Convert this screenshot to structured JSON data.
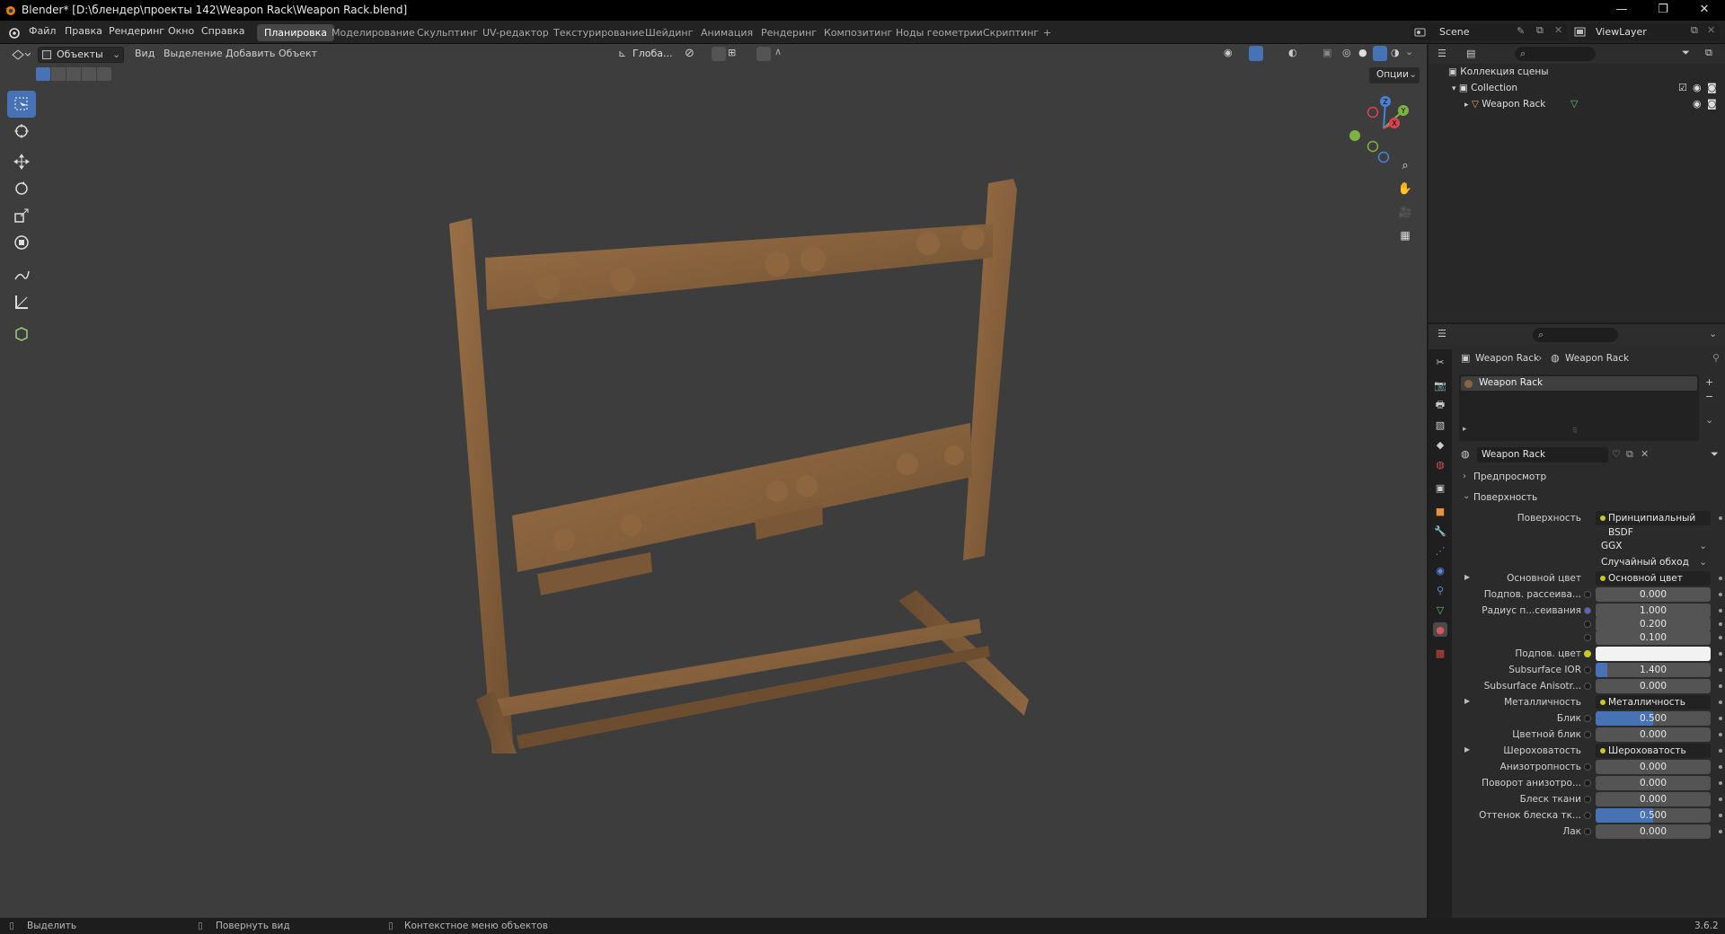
{
  "window": {
    "title": "Blender* [D:\\блендер\\проекты 142\\Weapon Rack\\Weapon Rack.blend]",
    "controls": [
      "—",
      "❐",
      "✕"
    ]
  },
  "menu": [
    "Файл",
    "Правка",
    "Рендеринг",
    "Окно",
    "Справка"
  ],
  "workspaces": [
    "Планировка",
    "Моделирование",
    "Скульптинг",
    "UV-редактор",
    "Текстурирование",
    "Шейдинг",
    "Анимация",
    "Рендеринг",
    "Композитинг",
    "Ноды геометрии",
    "Скриптинг",
    "+"
  ],
  "scene": {
    "label": "Scene",
    "view_layer": "ViewLayer"
  },
  "viewport_header": {
    "mode": "Объекты",
    "menus": [
      "Вид",
      "Выделение",
      "Добавить",
      "Объект"
    ],
    "orientation": "Глоба...",
    "options": "Опции"
  },
  "gizmo_axes": {
    "x": "X",
    "y": "Y",
    "z": "Z"
  },
  "outliner": {
    "scene_collection": "Коллекция сцены",
    "collection": "Collection",
    "object": "Weapon Rack"
  },
  "properties": {
    "breadcrumb_object": "Weapon Rack",
    "breadcrumb_material": "Weapon Rack",
    "slot": "Weapon Rack",
    "material_name": "Weapon Rack",
    "panel_preview": "Предпросмотр",
    "panel_surface": "Поверхность",
    "rows": [
      {
        "label": "Поверхность",
        "kind": "link",
        "value": "Принципиальный BSDF"
      },
      {
        "label": "",
        "kind": "select",
        "value": "GGX"
      },
      {
        "label": "",
        "kind": "select",
        "value": "Случайный обход"
      },
      {
        "label": "Основной цвет",
        "kind": "link",
        "value": "Основной цвет",
        "expand": true
      },
      {
        "label": "Подпов. рассеива...",
        "kind": "num",
        "value": "0.000",
        "fill": 0
      },
      {
        "label": "Радиус п...сеивания",
        "kind": "num",
        "value": "1.000",
        "fill": 0
      },
      {
        "label": "",
        "kind": "num",
        "value": "0.200",
        "fill": 0
      },
      {
        "label": "",
        "kind": "num",
        "value": "0.100",
        "fill": 0
      },
      {
        "label": "Подпов. цвет",
        "kind": "color",
        "value": "#f2f2f2"
      },
      {
        "label": "Subsurface IOR",
        "kind": "num",
        "value": "1.400",
        "fill": 0.1
      },
      {
        "label": "Subsurface Anisotr...",
        "kind": "num",
        "value": "0.000",
        "fill": 0
      },
      {
        "label": "Металличность",
        "kind": "link",
        "value": "Металличность",
        "expand": true
      },
      {
        "label": "Блик",
        "kind": "num",
        "value": "0.500",
        "fill": 0.5
      },
      {
        "label": "Цветной блик",
        "kind": "num",
        "value": "0.000",
        "fill": 0
      },
      {
        "label": "Шероховатость",
        "kind": "link",
        "value": "Шероховатость",
        "expand": true
      },
      {
        "label": "Анизотропность",
        "kind": "num",
        "value": "0.000",
        "fill": 0
      },
      {
        "label": "Поворот анизотро...",
        "kind": "num",
        "value": "0.000",
        "fill": 0
      },
      {
        "label": "Блеск ткани",
        "kind": "num",
        "value": "0.000",
        "fill": 0
      },
      {
        "label": "Оттенок блеска тк...",
        "kind": "num",
        "value": "0.500",
        "fill": 0.5
      },
      {
        "label": "Лак",
        "kind": "num",
        "value": "0.000",
        "fill": 0
      }
    ]
  },
  "statusbar": {
    "select": "Выделить",
    "rotate": "Повернуть вид",
    "context": "Контекстное меню объектов",
    "version": "3.6.2"
  },
  "colors": {
    "accent": "#4772b3",
    "wood": "#8a6440",
    "viewport_bg": "#3d3d3d"
  }
}
